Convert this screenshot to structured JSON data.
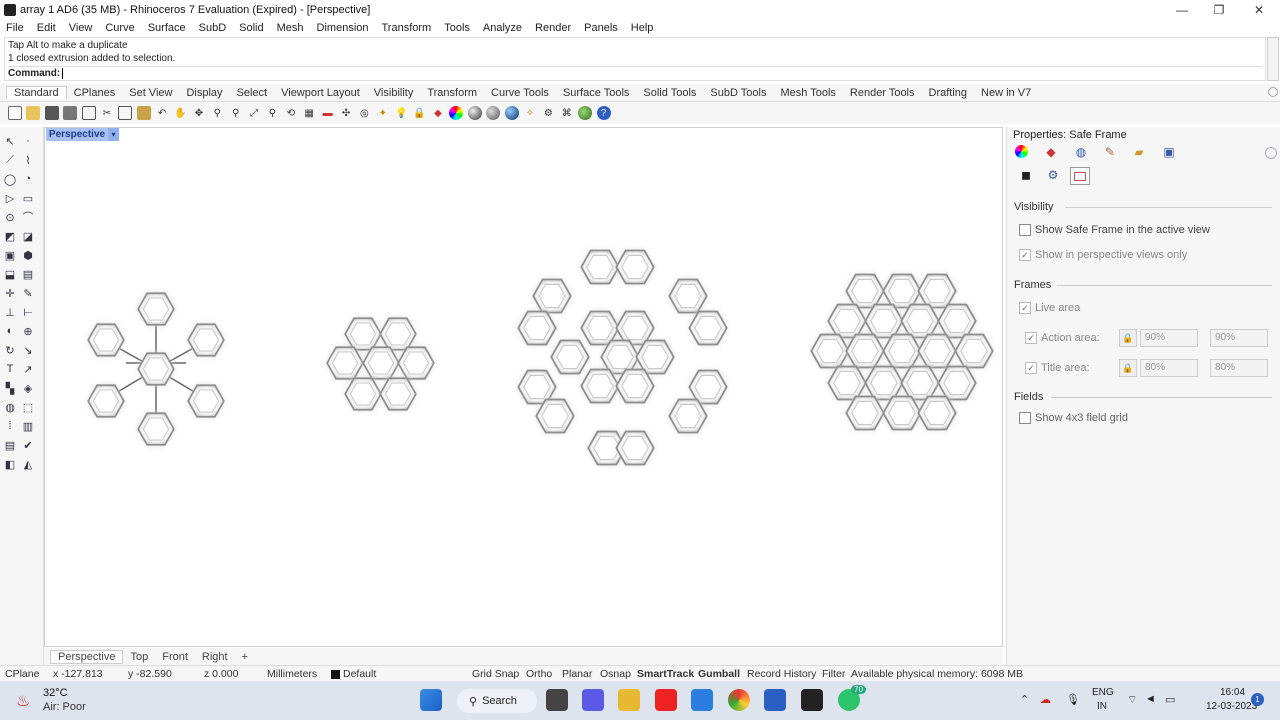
{
  "window": {
    "title": "array 1 AD6 (35 MB) - Rhinoceros 7 Evaluation (Expired) - [Perspective]",
    "minimize": "—",
    "maximize": "❐",
    "close": "✕"
  },
  "menu": [
    "File",
    "Edit",
    "View",
    "Curve",
    "Surface",
    "SubD",
    "Solid",
    "Mesh",
    "Dimension",
    "Transform",
    "Tools",
    "Analyze",
    "Render",
    "Panels",
    "Help"
  ],
  "command_history": {
    "line1": "Tap Alt to make a duplicate",
    "line2": "1 closed extrusion added to selection.",
    "prompt": "Command:"
  },
  "toolbar_tabs": [
    "Standard",
    "CPlanes",
    "Set View",
    "Display",
    "Select",
    "Viewport Layout",
    "Visibility",
    "Transform",
    "Curve Tools",
    "Surface Tools",
    "Solid Tools",
    "SubD Tools",
    "Mesh Tools",
    "Render Tools",
    "Drafting",
    "New in V7"
  ],
  "toolbar_tabs_active": "Standard",
  "viewport": {
    "label": "Perspective",
    "dropdown": "▾"
  },
  "view_tabs": [
    "Perspective",
    "Top",
    "Front",
    "Right",
    "+"
  ],
  "properties": {
    "title": "Properties: Safe Frame",
    "visibility_header": "Visibility",
    "show_safe_frame": "Show Safe Frame in the active view",
    "show_perspective_only": "Show in perspective views only",
    "frames_header": "Frames",
    "live_area": "Live area",
    "action_area": "Action area:",
    "action_w": "90%",
    "action_h": "90%",
    "title_area": "Title area:",
    "title_w": "80%",
    "title_h": "80%",
    "fields_header": "Fields",
    "show_grid": "Show 4x3 field grid"
  },
  "status": {
    "cplane": "CPlane",
    "x": "x -127.813",
    "y": "y -82.590",
    "z": "z 0.000",
    "units": "Millimeters",
    "layer": "Default",
    "grid_snap": "Grid Snap",
    "ortho": "Ortho",
    "planar": "Planar",
    "osnap": "Osnap",
    "smarttrack": "SmartTrack",
    "gumball": "Gumball",
    "record_history": "Record History",
    "filter": "Filter",
    "memory": "Available physical memory: 6098 MB"
  },
  "taskbar": {
    "temp": "32°C",
    "air": "Air: Poor",
    "search": "Search",
    "lang1": "ENG",
    "lang2": "IN",
    "time": "16:04",
    "date": "12-03-2023",
    "badge": "70",
    "notif": "1"
  },
  "colors": {
    "accent": "#a9c1f0",
    "taskbar": "#dde4ee"
  }
}
